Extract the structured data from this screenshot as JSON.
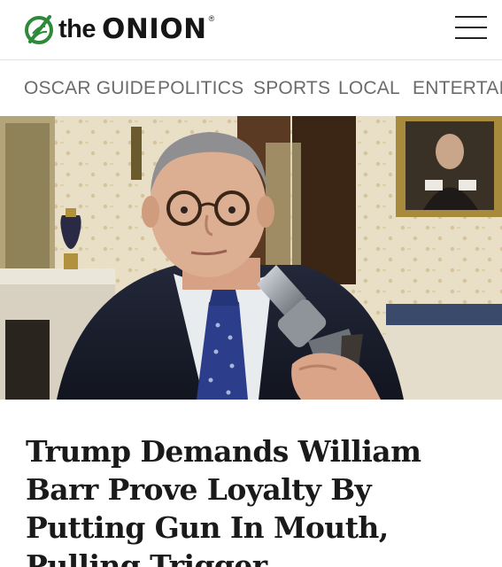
{
  "header": {
    "logo_the": "the",
    "logo_onion": "ONION",
    "logo_registered": "®"
  },
  "nav": {
    "items": [
      {
        "label": "OSCAR GUIDE"
      },
      {
        "label": "POLITICS"
      },
      {
        "label": "SPORTS"
      },
      {
        "label": "LOCAL"
      },
      {
        "label": "ENTERTAIN"
      }
    ]
  },
  "article": {
    "headline": "Trump Demands William Barr Prove Loyalty By Putting Gun In Mouth, Pulling Trigger"
  },
  "icons": {
    "logo": "onion-globe-icon",
    "menu": "hamburger-menu-icon"
  },
  "colors": {
    "brand_green": "#2c8a3a",
    "nav_text": "#6b6b6b",
    "headline_text": "#1a1a1a"
  }
}
